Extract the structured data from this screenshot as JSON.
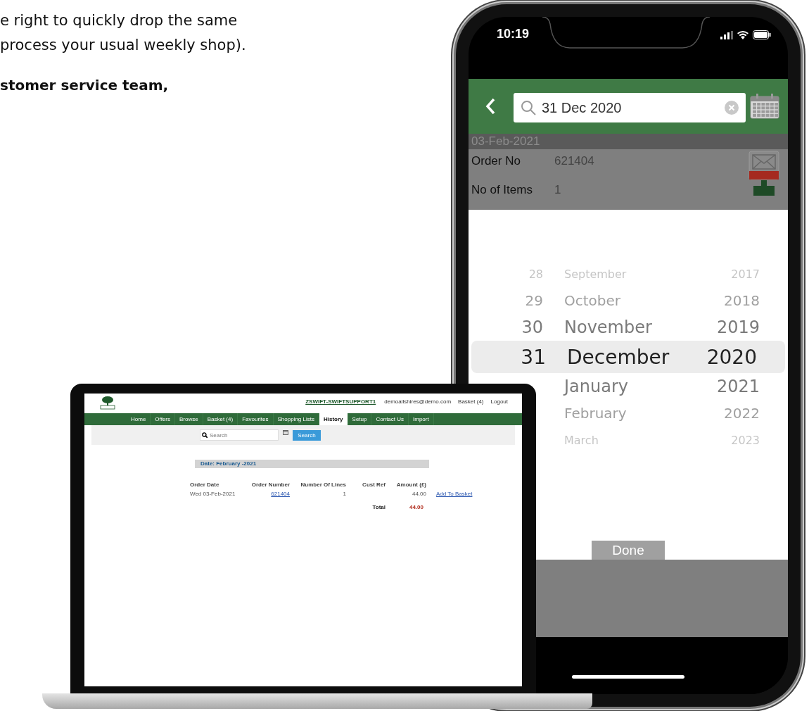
{
  "intro_text": {
    "lines": [
      "e right to quickly drop the same",
      "process your usual weekly shop)."
    ],
    "bold_line": "stomer service team,"
  },
  "laptop": {
    "user_link": "ZSWIFT-SWIFTSUPPORT1",
    "email": "demoallshires@demo.com",
    "basket": "Basket (4)",
    "logout": "Logout",
    "nav": [
      {
        "label": "Home",
        "selected": false
      },
      {
        "label": "Offers",
        "selected": false
      },
      {
        "label": "Browse",
        "selected": false
      },
      {
        "label": "Basket (4)",
        "selected": false
      },
      {
        "label": "Favourites",
        "selected": false
      },
      {
        "label": "Shopping Lists",
        "selected": false
      },
      {
        "label": "History",
        "selected": true
      },
      {
        "label": "Setup",
        "selected": false
      },
      {
        "label": "Contact Us",
        "selected": false
      },
      {
        "label": "Import",
        "selected": false
      }
    ],
    "search": {
      "placeholder": "Search"
    },
    "search_button": "Search",
    "date_header": "Date:  February -2021",
    "columns": [
      "Order Date",
      "Order Number",
      "Number Of Lines",
      "Cust Ref",
      "Amount (£)"
    ],
    "rows": [
      {
        "order_date": "Wed 03-Feb-2021",
        "order_number": "621404",
        "lines": "1",
        "amount": "44.00",
        "action": "Add To Basket"
      }
    ],
    "total_label": "Total",
    "total_value": "44.00"
  },
  "phone": {
    "time": "10:19",
    "search": {
      "value": "31 Dec 2020"
    },
    "date_bar": "03-Feb-2021",
    "order": {
      "order_no_label": "Order No",
      "order_no": "621404",
      "items_label": "No of Items",
      "items": "1"
    },
    "picker": [
      {
        "day": "28",
        "month": "September",
        "year": "2017",
        "selected": false
      },
      {
        "day": "29",
        "month": "October",
        "year": "2018",
        "selected": false
      },
      {
        "day": "30",
        "month": "November",
        "year": "2019",
        "selected": false
      },
      {
        "day": "31",
        "month": "December",
        "year": "2020",
        "selected": true
      },
      {
        "month": "January",
        "year": "2021",
        "selected": false
      },
      {
        "month": "February",
        "year": "2022",
        "selected": false
      },
      {
        "month": "March",
        "year": "2023",
        "selected": false
      }
    ],
    "done": "Done"
  }
}
